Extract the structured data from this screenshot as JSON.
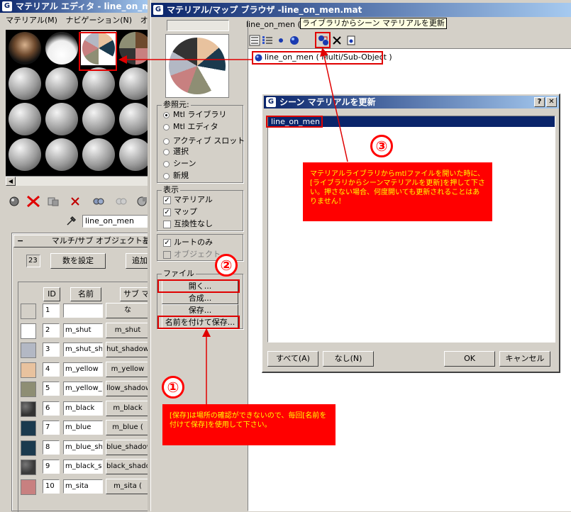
{
  "editor": {
    "title": "マテリアル エディタ - line_on_men",
    "menu": [
      "マテリアル(M)",
      "ナビゲーション(N)",
      "オプショ"
    ],
    "name_field": "line_on_men",
    "rollout_title": "マルチ/サブ オブジェクト基",
    "count": "23",
    "set_count_button": "数を設定",
    "add_button": "追加",
    "col_id": "ID",
    "col_name": "名前",
    "col_sub": "サブ マ",
    "rows": [
      {
        "id": "1",
        "name": "",
        "sub": "な",
        "color": "#d4d0c8"
      },
      {
        "id": "2",
        "name": "m_shut",
        "sub": "m_shut",
        "color": "#ffffff"
      },
      {
        "id": "3",
        "name": "m_shut_sh",
        "sub": "hut_shadow",
        "color": "#b3b8c4"
      },
      {
        "id": "4",
        "name": "m_yellow",
        "sub": "m_yellow",
        "color": "#e8c29e"
      },
      {
        "id": "5",
        "name": "m_yellow_",
        "sub": "llow_shadow",
        "color": "#8e8e74"
      },
      {
        "id": "6",
        "name": "m_black",
        "sub": "m_black",
        "color": "#333333"
      },
      {
        "id": "7",
        "name": "m_blue",
        "sub": "m_blue (",
        "color": "#1b3a4e"
      },
      {
        "id": "8",
        "name": "m_blue_sh",
        "sub": "blue_shadow",
        "color": "#1b3a4e"
      },
      {
        "id": "9",
        "name": "m_black_sh",
        "sub": "black_shadow",
        "color": "#3a3a3a"
      },
      {
        "id": "10",
        "name": "m_sita",
        "sub": "m_sita (",
        "color": "#c88080"
      }
    ]
  },
  "browser": {
    "title": "マテリアル/マップ ブラウザ -line_on_men.mat",
    "header_name": "line_on_men (",
    "tooltip": "ライブラリからシーン マテリアルを更新",
    "tree_item": "line_on_men ( Multi/Sub-Object )",
    "ref_group": "参照元:",
    "ref_options": [
      "Mtl ライブラリ",
      "Mtl エディタ",
      "アクティブ スロット",
      "選択",
      "シーン",
      "新規"
    ],
    "display_group": "表示",
    "display_options": [
      {
        "label": "マテリアル",
        "checked": true
      },
      {
        "label": "マップ",
        "checked": true
      },
      {
        "label": "互換性なし",
        "checked": false
      }
    ],
    "root_only": "ルートのみ",
    "object_label": "オブジェクト",
    "file_group": "ファイル",
    "file_buttons": [
      "開く...",
      "合成...",
      "保存...",
      "名前を付けて保存..."
    ]
  },
  "dialog": {
    "title": "シーン マテリアルを更新",
    "help": "?",
    "close": "✕",
    "list_item": "line_on_men",
    "all_button": "すべて(A)",
    "none_button": "なし(N)",
    "ok_button": "OK",
    "cancel_button": "キャンセル"
  },
  "annotations": {
    "n1": "①",
    "n2": "②",
    "n3": "③",
    "note1": "[保存]は場所の確認ができないので、毎回[名前を付けて保存]を使用して下さい。",
    "note3": "マテリアルライブラリからmtlファイルを開いた時に、[ライブラリからシーンマテリアルを更新]を押して下さい。押さない場合、何度開いても更新されることはありません！"
  }
}
